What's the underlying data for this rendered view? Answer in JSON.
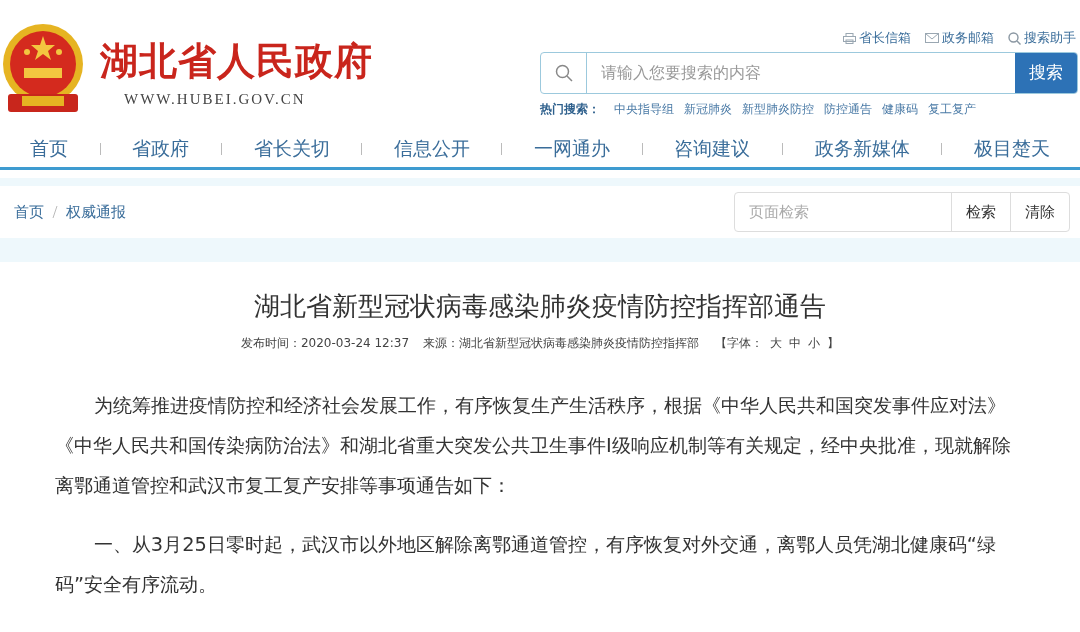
{
  "header": {
    "site_name": "湖北省人民政府",
    "site_url": "WWW.HUBEI.GOV.CN",
    "top_links": [
      {
        "kind": "mail",
        "label": "省长信箱"
      },
      {
        "kind": "envelope",
        "label": "政务邮箱"
      },
      {
        "kind": "search",
        "label": "搜索助手"
      }
    ],
    "search": {
      "placeholder": "请输入您要搜索的内容",
      "button": "搜索"
    },
    "hot_search": {
      "label": "热门搜索：",
      "terms": [
        "中央指导组",
        "新冠肺炎",
        "新型肺炎防控",
        "防控通告",
        "健康码",
        "复工复产"
      ]
    }
  },
  "nav": [
    "首页",
    "省政府",
    "省长关切",
    "信息公开",
    "一网通办",
    "咨询建议",
    "政务新媒体",
    "极目楚天"
  ],
  "breadcrumb": [
    "首页",
    "权威通报"
  ],
  "page_search": {
    "placeholder": "页面检索",
    "buttons": [
      "检索",
      "清除"
    ]
  },
  "article": {
    "title": "湖北省新型冠状病毒感染肺炎疫情防控指挥部通告",
    "published": "发布时间：2020-03-24 12:37",
    "source": "来源：湖北省新型冠状病毒感染肺炎疫情防控指挥部",
    "font_size": {
      "open": "【字体：",
      "options": [
        "大",
        "中",
        "小"
      ],
      "close": "】"
    },
    "paragraphs": [
      "为统筹推进疫情防控和经济社会发展工作，有序恢复生产生活秩序，根据《中华人民共和国突发事件应对法》《中华人民共和国传染病防治法》和湖北省重大突发公共卫生事件I级响应机制等有关规定，经中央批准，现就解除离鄂通道管控和武汉市复工复产安排等事项通告如下：",
      "一、从3月25日零时起，武汉市以外地区解除离鄂通道管控，有序恢复对外交通，离鄂人员凭湖北健康码“绿码”安全有序流动。"
    ]
  }
}
